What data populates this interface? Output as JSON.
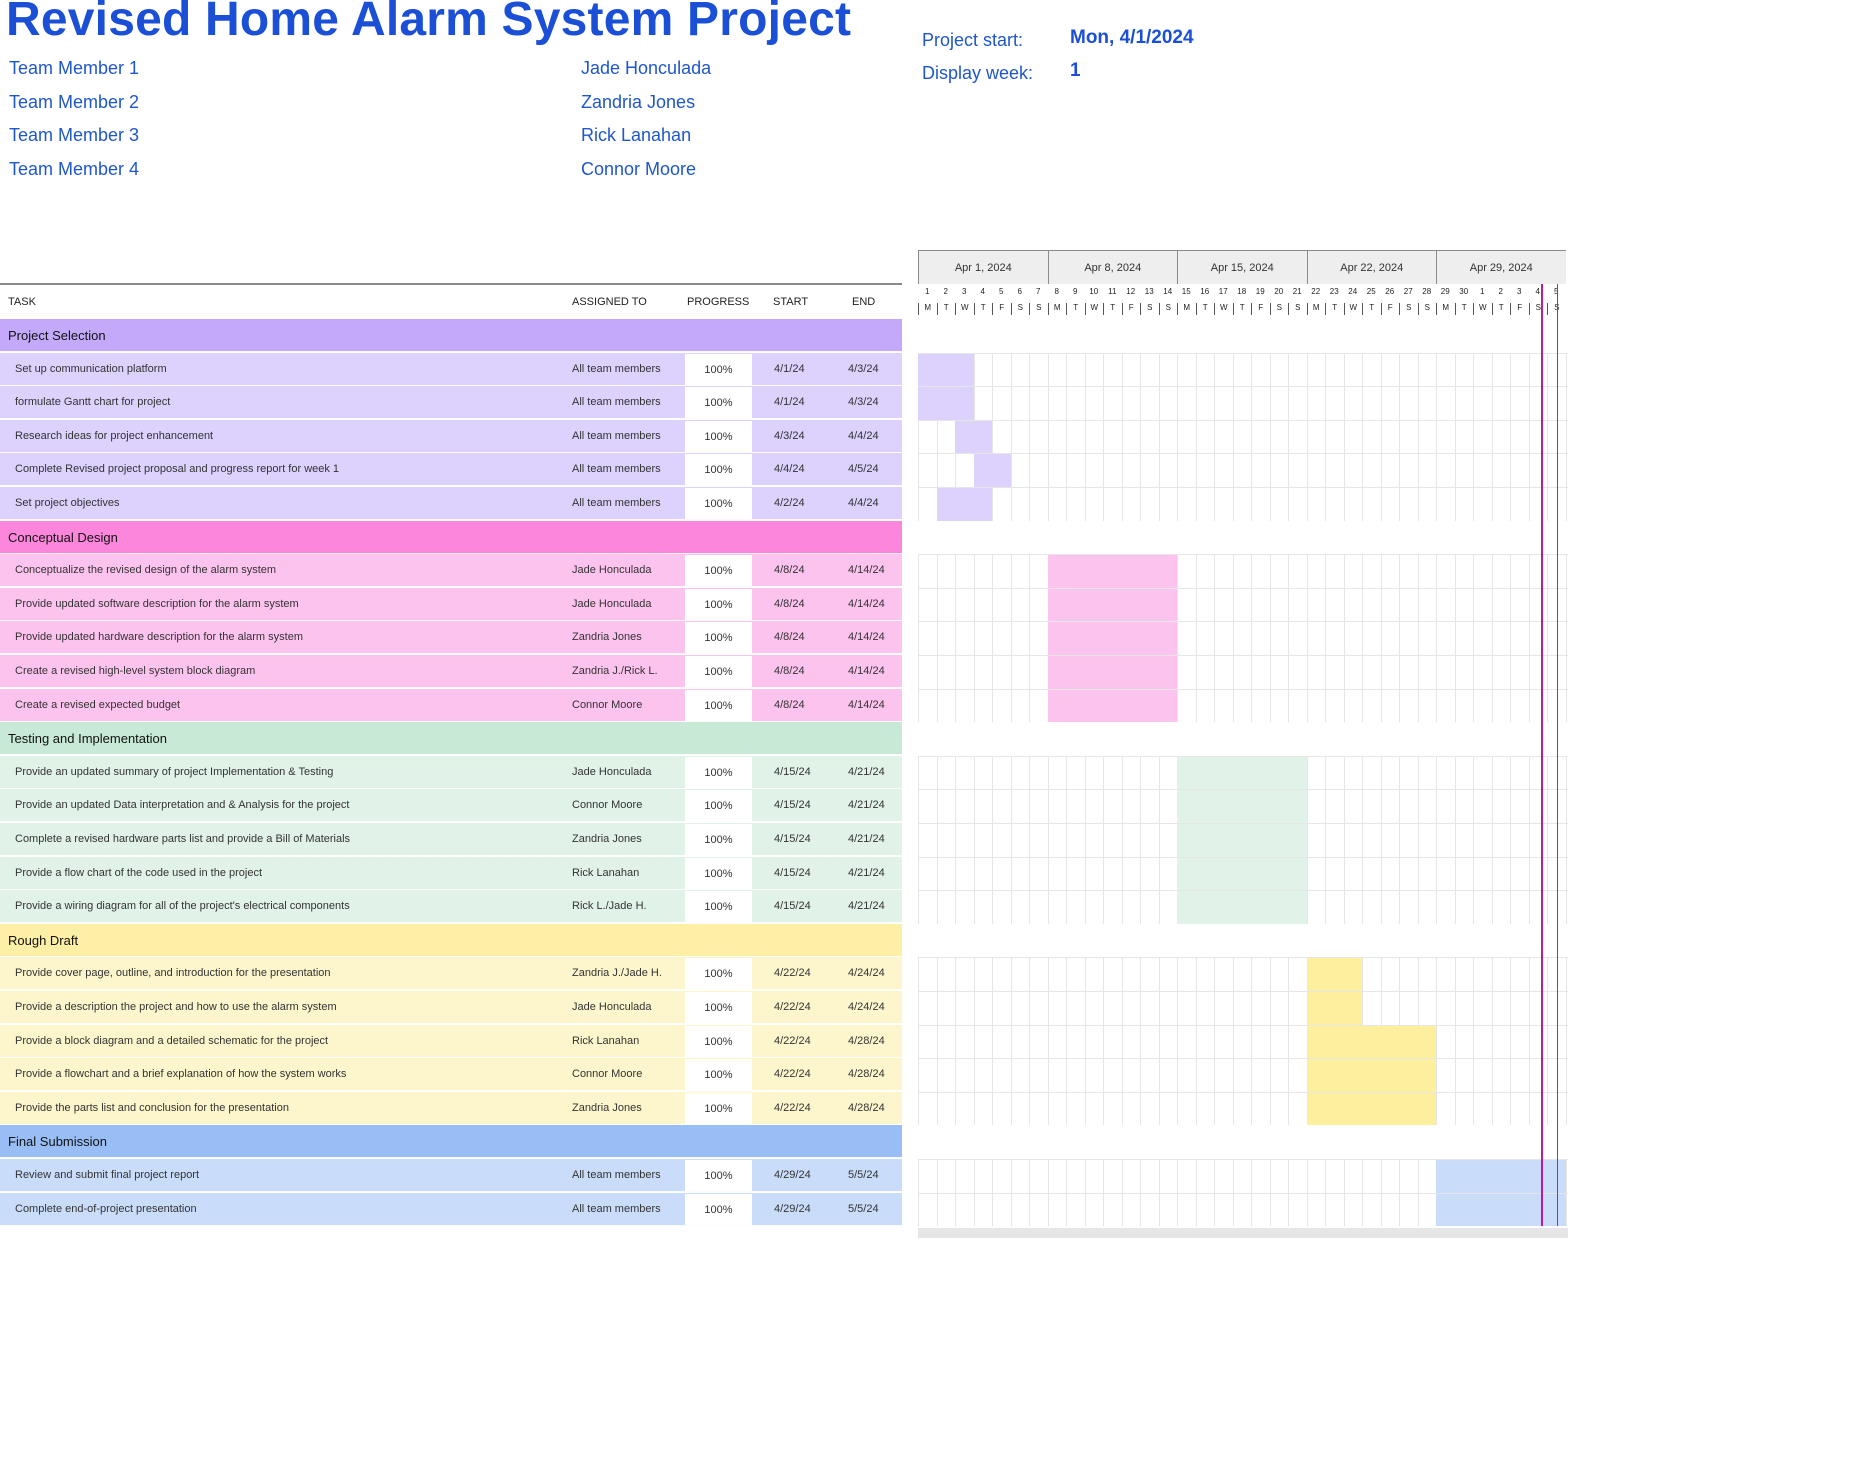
{
  "title": "Revised Home Alarm System Project",
  "team": [
    {
      "label": "Team Member 1",
      "name": "Jade Honculada"
    },
    {
      "label": "Team Member 2",
      "name": "Zandria Jones"
    },
    {
      "label": "Team Member 3",
      "name": "Rick Lanahan"
    },
    {
      "label": "Team Member 4",
      "name": "Connor Moore"
    }
  ],
  "project": {
    "start_label": "Project start:",
    "start_value": "Mon, 4/1/2024",
    "week_label": "Display week:",
    "week_value": "1"
  },
  "columns": {
    "task": "TASK",
    "assigned": "ASSIGNED TO",
    "progress": "PROGRESS",
    "start": "START",
    "end": "END"
  },
  "phases": [
    {
      "name": "Project Selection",
      "header_color": "#c4a9fb",
      "row_color": "#ddd1fd",
      "bar_color": "#ddd1fd",
      "tasks": [
        {
          "task": "Set up communication platform",
          "assigned": "All team members",
          "progress": "100%",
          "start": "4/1/24",
          "end": "4/3/24"
        },
        {
          "task": "formulate Gantt chart for project",
          "assigned": "All team members",
          "progress": "100%",
          "start": "4/1/24",
          "end": "4/3/24"
        },
        {
          "task": "Research ideas for project enhancement",
          "assigned": "All team members",
          "progress": "100%",
          "start": "4/3/24",
          "end": "4/4/24"
        },
        {
          "task": "Complete Revised project proposal and progress report for week 1",
          "assigned": "All team members",
          "progress": "100%",
          "start": "4/4/24",
          "end": "4/5/24"
        },
        {
          "task": "Set project objectives",
          "assigned": "All team members",
          "progress": "100%",
          "start": "4/2/24",
          "end": "4/4/24"
        }
      ]
    },
    {
      "name": "Conceptual Design",
      "header_color": "#fd86dd",
      "row_color": "#fdc3ef",
      "bar_color": "#fdc3ef",
      "tasks": [
        {
          "task": "Conceptualize the revised design of the alarm system",
          "assigned": "Jade Honculada",
          "progress": "100%",
          "start": "4/8/24",
          "end": "4/14/24"
        },
        {
          "task": "Provide updated software description for the alarm system",
          "assigned": "Jade Honculada",
          "progress": "100%",
          "start": "4/8/24",
          "end": "4/14/24"
        },
        {
          "task": "Provide updated hardware description for the alarm system",
          "assigned": "Zandria Jones",
          "progress": "100%",
          "start": "4/8/24",
          "end": "4/14/24"
        },
        {
          "task": "Create a revised high-level system block diagram",
          "assigned": "Zandria J./Rick L.",
          "progress": "100%",
          "start": "4/8/24",
          "end": "4/14/24"
        },
        {
          "task": "Create a revised expected budget",
          "assigned": "Connor Moore",
          "progress": "100%",
          "start": "4/8/24",
          "end": "4/14/24"
        }
      ]
    },
    {
      "name": "Testing and Implementation",
      "header_color": "#c7e9d6",
      "row_color": "#e1f2e9",
      "bar_color": "#e1f2e9",
      "tasks": [
        {
          "task": "Provide an updated summary of project Implementation & Testing",
          "assigned": "Jade Honculada",
          "progress": "100%",
          "start": "4/15/24",
          "end": "4/21/24"
        },
        {
          "task": "Provide an updated Data interpretation and & Analysis for the project",
          "assigned": "Connor Moore",
          "progress": "100%",
          "start": "4/15/24",
          "end": "4/21/24"
        },
        {
          "task": "Complete a revised hardware parts list and provide a Bill of Materials",
          "assigned": "Zandria Jones",
          "progress": "100%",
          "start": "4/15/24",
          "end": "4/21/24"
        },
        {
          "task": "Provide a flow chart of the code used in the project",
          "assigned": "Rick Lanahan",
          "progress": "100%",
          "start": "4/15/24",
          "end": "4/21/24"
        },
        {
          "task": "Provide a wiring diagram for all of the project's electrical components",
          "assigned": "Rick L./Jade H.",
          "progress": "100%",
          "start": "4/15/24",
          "end": "4/21/24"
        }
      ]
    },
    {
      "name": "Rough Draft",
      "header_color": "#fdf0a6",
      "row_color": "#fdf6cc",
      "bar_color": "#fcef9e",
      "tasks": [
        {
          "task": "Provide cover page, outline, and introduction for the presentation",
          "assigned": "Zandria J./Jade H.",
          "progress": "100%",
          "start": "4/22/24",
          "end": "4/24/24"
        },
        {
          "task": "Provide a description the project and how to use the alarm system",
          "assigned": "Jade Honculada",
          "progress": "100%",
          "start": "4/22/24",
          "end": "4/24/24"
        },
        {
          "task": "Provide a block diagram and a detailed schematic for the project",
          "assigned": "Rick Lanahan",
          "progress": "100%",
          "start": "4/22/24",
          "end": "4/28/24"
        },
        {
          "task": "Provide a flowchart and a brief explanation of how the system works",
          "assigned": "Connor Moore",
          "progress": "100%",
          "start": "4/22/24",
          "end": "4/28/24"
        },
        {
          "task": "Provide the parts list and conclusion for the presentation",
          "assigned": "Zandria Jones",
          "progress": "100%",
          "start": "4/22/24",
          "end": "4/28/24"
        }
      ]
    },
    {
      "name": "Final Submission",
      "header_color": "#98bef5",
      "row_color": "#c9ddfa",
      "bar_color": "#c9ddfa",
      "tasks": [
        {
          "task": "Review and submit final project report",
          "assigned": "All team members",
          "progress": "100%",
          "start": "4/29/24",
          "end": "5/5/24"
        },
        {
          "task": "Complete end-of-project presentation",
          "assigned": "All team members",
          "progress": "100%",
          "start": "4/29/24",
          "end": "5/5/24"
        }
      ]
    }
  ],
  "gantt": {
    "weeks": [
      "Apr 1, 2024",
      "Apr 8, 2024",
      "Apr 15, 2024",
      "Apr 22, 2024",
      "Apr 29, 2024"
    ],
    "day_numbers": [
      "1",
      "2",
      "3",
      "4",
      "5",
      "6",
      "7",
      "8",
      "9",
      "10",
      "11",
      "12",
      "13",
      "14",
      "15",
      "16",
      "17",
      "18",
      "19",
      "20",
      "21",
      "22",
      "23",
      "24",
      "25",
      "26",
      "27",
      "28",
      "29",
      "30",
      "1",
      "2",
      "3",
      "4",
      "5"
    ],
    "day_letters": [
      "M",
      "T",
      "W",
      "T",
      "F",
      "S",
      "S",
      "M",
      "T",
      "W",
      "T",
      "F",
      "S",
      "S",
      "M",
      "T",
      "W",
      "T",
      "F",
      "S",
      "S",
      "M",
      "T",
      "W",
      "T",
      "F",
      "S",
      "S",
      "M",
      "T",
      "W",
      "T",
      "F",
      "S",
      "S"
    ],
    "today_day_index": 34
  }
}
